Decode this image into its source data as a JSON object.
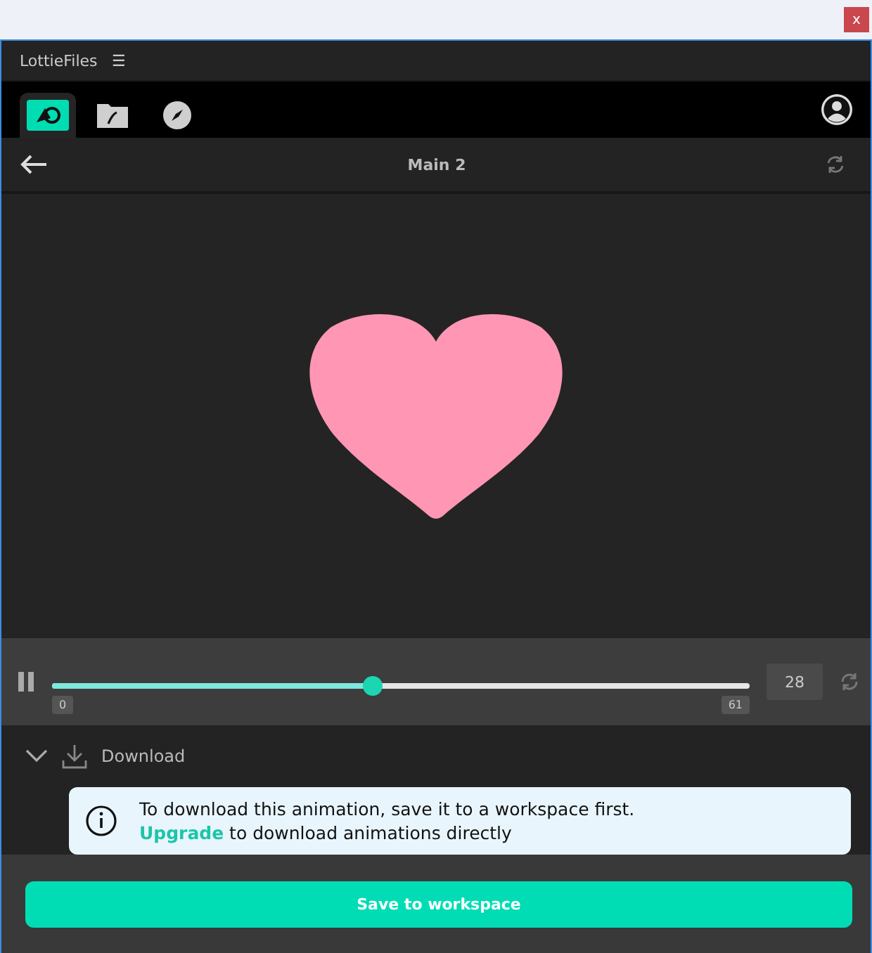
{
  "window": {
    "close_label": "x"
  },
  "app_bar": {
    "title": "LottieFiles",
    "menu_glyph": "☰"
  },
  "tabs": [
    {
      "kind": "animations",
      "selected": true
    },
    {
      "kind": "folder",
      "selected": false
    },
    {
      "kind": "discover",
      "selected": false
    }
  ],
  "toolbar": {
    "title": "Main 2"
  },
  "player": {
    "level": 0.46,
    "start": "0",
    "end": "61",
    "frame": "28"
  },
  "download": {
    "label": "Download",
    "expanded": true,
    "notice": "To download this animation, save it to a workspace first.",
    "link": "Upgrade",
    "notice_rest": " to download animations directly"
  },
  "footer": {
    "button": "Save to workspace"
  }
}
